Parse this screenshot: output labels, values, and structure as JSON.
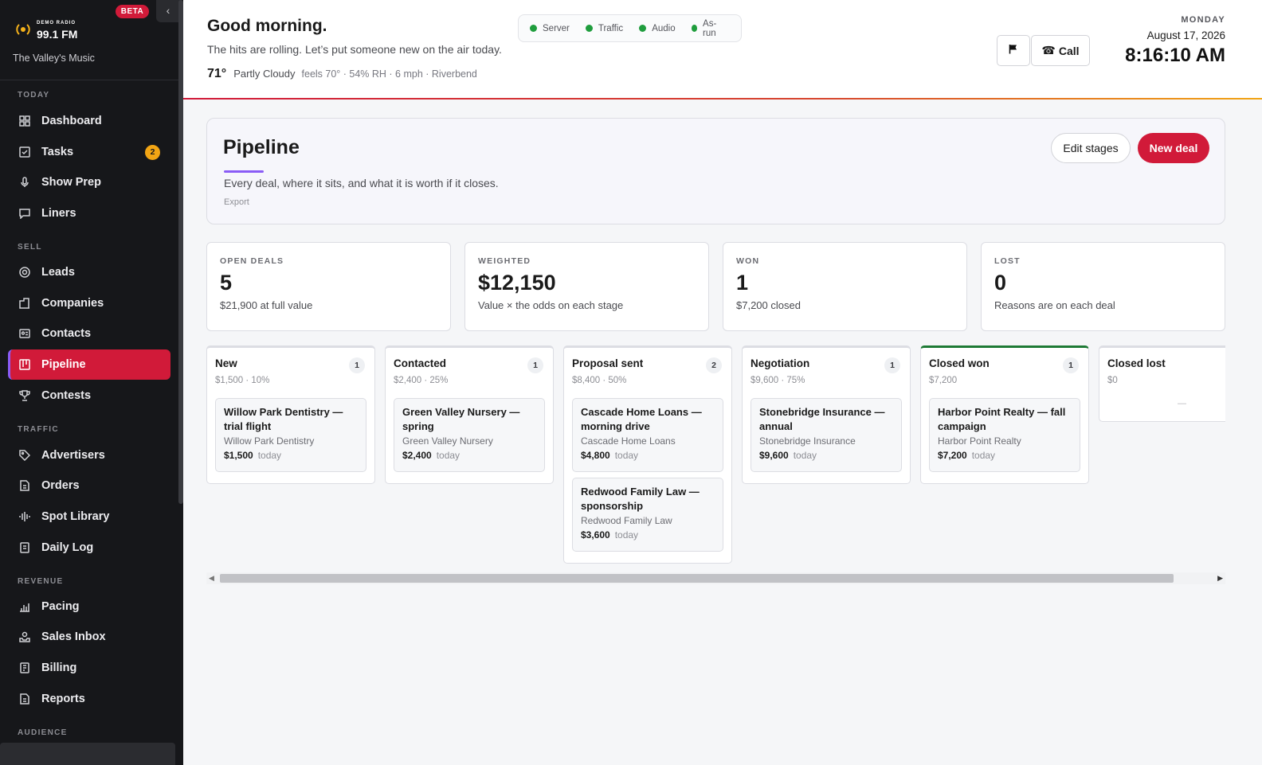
{
  "sidebar": {
    "brand_small": "DEMO RADIO",
    "brand_freq": "99.1 FM",
    "beta": "BETA",
    "tagline": "The Valley's Music",
    "sections": {
      "today": "TODAY",
      "sell": "SELL",
      "traffic": "TRAFFIC",
      "revenue": "REVENUE",
      "audience": "AUDIENCE"
    },
    "items": {
      "dashboard": "Dashboard",
      "tasks": "Tasks",
      "tasks_badge": "2",
      "show_prep": "Show Prep",
      "liners": "Liners",
      "leads": "Leads",
      "companies": "Companies",
      "contacts": "Contacts",
      "pipeline": "Pipeline",
      "contests": "Contests",
      "advertisers": "Advertisers",
      "orders": "Orders",
      "spot_library": "Spot Library",
      "daily_log": "Daily Log",
      "pacing": "Pacing",
      "sales_inbox": "Sales Inbox",
      "billing": "Billing",
      "reports": "Reports"
    }
  },
  "header": {
    "greeting": "Good morning.",
    "subtitle": "The hits are rolling. Let’s put someone new on the air today.",
    "temp": "71°",
    "condition": "Partly Cloudy",
    "weather_detail": "feels 70° · 54% RH · 6 mph · Riverbend",
    "status": [
      "Server",
      "Traffic",
      "Audio",
      "As-run"
    ],
    "call_label": "Call",
    "day": "MONDAY",
    "date": "August 17, 2026",
    "time": "8:16:10 AM"
  },
  "pipeline": {
    "title": "Pipeline",
    "subtitle": "Every deal, where it sits, and what it is worth if it closes.",
    "export": "Export",
    "edit_stages": "Edit stages",
    "new_deal": "New deal"
  },
  "stats": [
    {
      "label": "OPEN DEALS",
      "value": "5",
      "sub": "$21,900 at full value"
    },
    {
      "label": "WEIGHTED",
      "value": "$12,150",
      "sub": "Value × the odds on each stage"
    },
    {
      "label": "WON",
      "value": "1",
      "sub": "$7,200 closed"
    },
    {
      "label": "LOST",
      "value": "0",
      "sub": "Reasons are on each deal"
    }
  ],
  "columns": [
    {
      "title": "New",
      "count": "1",
      "meta": "$1,500 · 10%",
      "cards": [
        {
          "title": "Willow Park Dentistry — trial flight",
          "company": "Willow Park Dentistry",
          "amount": "$1,500",
          "when": "today"
        }
      ]
    },
    {
      "title": "Contacted",
      "count": "1",
      "meta": "$2,400 · 25%",
      "cards": [
        {
          "title": "Green Valley Nursery — spring",
          "company": "Green Valley Nursery",
          "amount": "$2,400",
          "when": "today"
        }
      ]
    },
    {
      "title": "Proposal sent",
      "count": "2",
      "meta": "$8,400 · 50%",
      "cards": [
        {
          "title": "Cascade Home Loans — morning drive",
          "company": "Cascade Home Loans",
          "amount": "$4,800",
          "when": "today"
        },
        {
          "title": "Redwood Family Law — sponsorship",
          "company": "Redwood Family Law",
          "amount": "$3,600",
          "when": "today"
        }
      ]
    },
    {
      "title": "Negotiation",
      "count": "1",
      "meta": "$9,600 · 75%",
      "cards": [
        {
          "title": "Stonebridge Insurance — annual",
          "company": "Stonebridge Insurance",
          "amount": "$9,600",
          "when": "today"
        }
      ]
    },
    {
      "title": "Closed won",
      "count": "1",
      "meta": "$7,200",
      "cards": [
        {
          "title": "Harbor Point Realty — fall campaign",
          "company": "Harbor Point Realty",
          "amount": "$7,200",
          "when": "today"
        }
      ]
    },
    {
      "title": "Closed lost",
      "meta": "$0",
      "empty": "—"
    }
  ],
  "colors": {
    "accent": "#d11a39",
    "sidebar_bg": "#16171a",
    "badge": "#f2a514",
    "status_ok": "#1f9d3d",
    "underline": "#8a5cf6",
    "won": "#1e7a35"
  }
}
